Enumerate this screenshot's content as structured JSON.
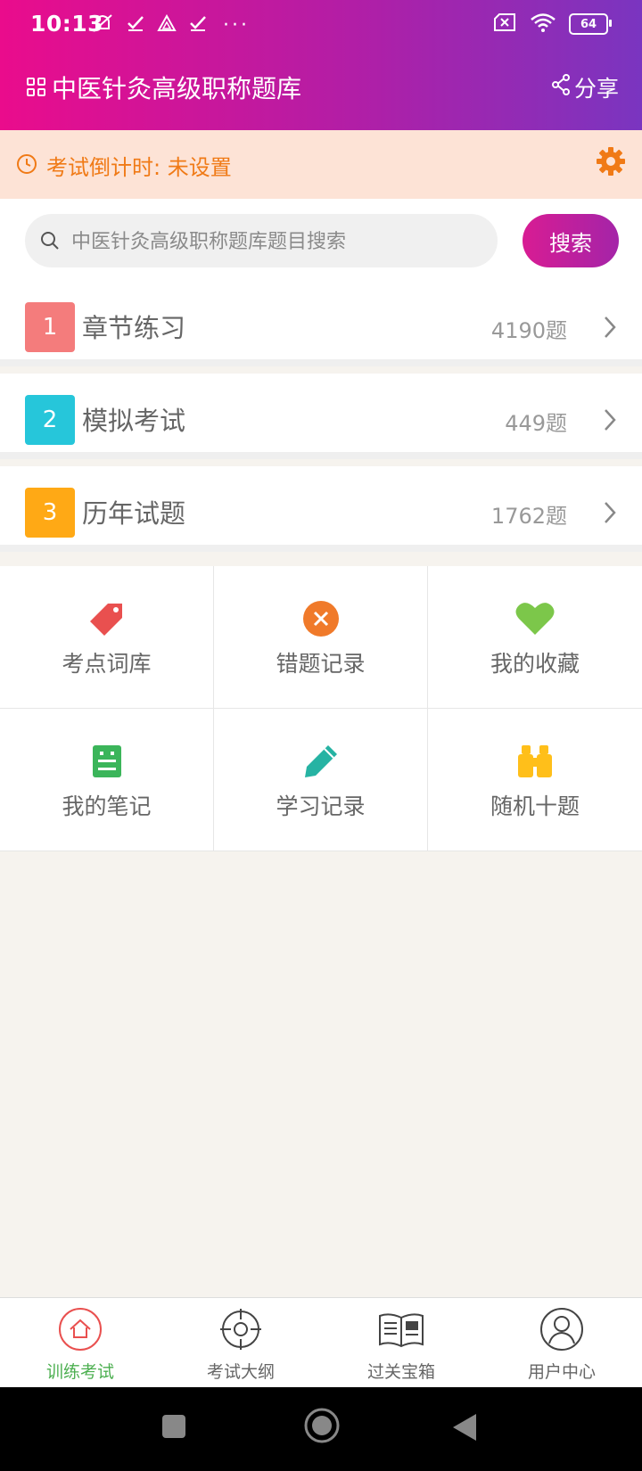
{
  "status_bar": {
    "time": "10:13",
    "battery": "64",
    "dots": "···"
  },
  "header": {
    "title": "中医针灸高级职称题库",
    "share_label": "分享"
  },
  "countdown": {
    "label": "考试倒计时: 未设置"
  },
  "search": {
    "placeholder": "中医针灸高级职称题库题目搜索",
    "button_label": "搜索"
  },
  "sections": [
    {
      "number": "1",
      "label": "章节练习",
      "count": "4190题",
      "color": "#f47c7c"
    },
    {
      "number": "2",
      "label": "模拟考试",
      "count": "449题",
      "color": "#26c6da"
    },
    {
      "number": "3",
      "label": "历年试题",
      "count": "1762题",
      "color": "#ffa915"
    }
  ],
  "tools": [
    {
      "label": "考点词库",
      "icon": "tag-icon",
      "color": "#e9504f"
    },
    {
      "label": "错题记录",
      "icon": "close-circle-icon",
      "color": "#f07a2a"
    },
    {
      "label": "我的收藏",
      "icon": "heart-icon",
      "color": "#7cc74a"
    },
    {
      "label": "我的笔记",
      "icon": "notepad-icon",
      "color": "#3bb55a"
    },
    {
      "label": "学习记录",
      "icon": "pencil-icon",
      "color": "#26b3a3"
    },
    {
      "label": "随机十题",
      "icon": "binoculars-icon",
      "color": "#ffbf1a"
    }
  ],
  "tabs": [
    {
      "label": "训练考试",
      "icon": "home-icon",
      "active": true
    },
    {
      "label": "考试大纲",
      "icon": "target-icon",
      "active": false
    },
    {
      "label": "过关宝箱",
      "icon": "book-icon",
      "active": false
    },
    {
      "label": "用户中心",
      "icon": "user-icon",
      "active": false
    }
  ]
}
